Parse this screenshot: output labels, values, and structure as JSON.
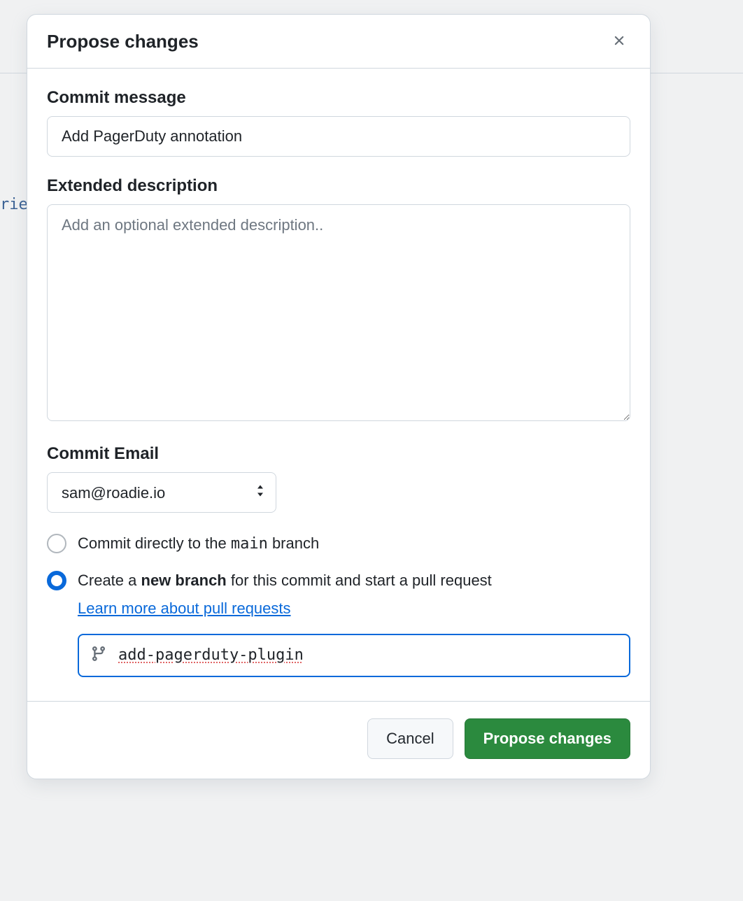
{
  "bg_code": "rie",
  "dialog": {
    "title": "Propose changes"
  },
  "commit_message": {
    "label": "Commit message",
    "value": "Add PagerDuty annotation"
  },
  "extended_description": {
    "label": "Extended description",
    "placeholder": "Add an optional extended description.."
  },
  "commit_email": {
    "label": "Commit Email",
    "value": "sam@roadie.io"
  },
  "branch_option": {
    "direct_pre": "Commit directly to the ",
    "direct_branch": "main",
    "direct_post": " branch",
    "create_pre": "Create a ",
    "create_bold": "new branch",
    "create_post": " for this commit and start a pull request",
    "learn_more": "Learn more about pull requests",
    "branch_name": "add-pagerduty-plugin"
  },
  "footer": {
    "cancel": "Cancel",
    "propose": "Propose changes"
  }
}
